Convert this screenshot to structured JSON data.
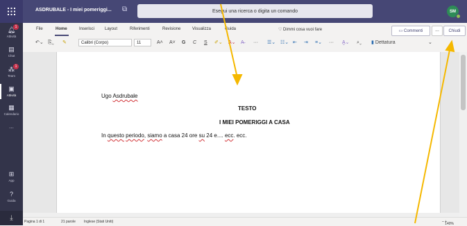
{
  "titlebar": {
    "doc_title": "ASDRUBALE - I miei pomeriggi...",
    "search_placeholder": "Esegui una ricerca o digita un comando",
    "avatar_initials": "SM"
  },
  "rail": {
    "items": [
      {
        "label": "Attività",
        "icon": "bell-icon",
        "badge": "1"
      },
      {
        "label": "Chat",
        "icon": "chat-icon"
      },
      {
        "label": "Team",
        "icon": "team-icon",
        "badge": "1"
      },
      {
        "label": "Attività",
        "icon": "assignments-icon"
      },
      {
        "label": "Calendario",
        "icon": "calendar-icon"
      },
      {
        "label": "...",
        "icon": "more-icon"
      }
    ],
    "bottom": [
      {
        "label": "App",
        "icon": "apps-icon"
      },
      {
        "label": "Guida",
        "icon": "help-icon"
      }
    ]
  },
  "ribbon": {
    "tabs": [
      "File",
      "Home",
      "Inserisci",
      "Layout",
      "Riferimenti",
      "Revisione",
      "Visualizza",
      "Guida"
    ],
    "tell_me": "Dimmi cosa vuoi fare",
    "comments_label": "Commenti",
    "more_label": "...",
    "close_label": "Chiudi",
    "font_name": "Calibri (Corpo)",
    "font_size": "11",
    "dictate_label": "Dettatura"
  },
  "document": {
    "author": "Ugo Asdrubale",
    "heading1": "TESTO",
    "heading2": "I MIEI POMERIGGI A CASA",
    "body": "In questo periodo, siamo a casa 24 ore su 24 e.... ecc. ecc."
  },
  "status": {
    "page": "Pagina 1 di 1",
    "words": "21 parole",
    "language": "Inglese (Stati Uniti)",
    "zoom": "140%"
  },
  "colors": {
    "teams_purple": "#464775",
    "rail": "#33344a",
    "arrow": "#f5b800"
  }
}
